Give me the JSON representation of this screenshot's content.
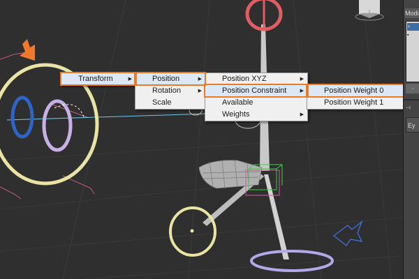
{
  "menus": {
    "level1": [
      {
        "label": "Transform",
        "has_submenu": true,
        "highlighted": true
      }
    ],
    "level2": [
      {
        "label": "Position",
        "has_submenu": true,
        "highlighted": true
      },
      {
        "label": "Rotation",
        "has_submenu": true,
        "highlighted": false
      },
      {
        "label": "Scale",
        "has_submenu": false,
        "highlighted": false
      }
    ],
    "level3": [
      {
        "label": "Position XYZ",
        "has_submenu": true,
        "highlighted": false
      },
      {
        "label": "Position Constraint",
        "has_submenu": true,
        "highlighted": true
      },
      {
        "label": "Available",
        "has_submenu": false,
        "highlighted": false
      },
      {
        "label": "Weights",
        "has_submenu": true,
        "highlighted": false
      }
    ],
    "level4": [
      {
        "label": "Position Weight 0",
        "has_submenu": false,
        "highlighted": true
      },
      {
        "label": "Position Weight 1",
        "has_submenu": false,
        "highlighted": false
      }
    ]
  },
  "submenu_arrow": "▶",
  "side_panel": {
    "tab_label": "Modi",
    "panel_label": "Ey",
    "list_items": [
      "♀",
      "▪",
      "",
      "",
      "",
      "",
      ""
    ],
    "button_label": "-",
    "row_label": "⊣"
  },
  "colors": {
    "menu_bg": "#f0f0f0",
    "highlight_outline": "#e87a2a",
    "viewport_bg": "#2f2f2f",
    "ring_yellow": "#e9e4a4",
    "ring_blue": "#2e64c7",
    "ring_purple": "#c7b0e6",
    "ring_red": "#e25c64",
    "ring_lavender": "#b2a9e9",
    "pointer_arrow": "#f07828",
    "helper_blue": "#3c6fd2"
  },
  "icons": [
    "pointer-arrow-icon",
    "submenu-arrow-icon",
    "manipulator-helper-icon"
  ]
}
